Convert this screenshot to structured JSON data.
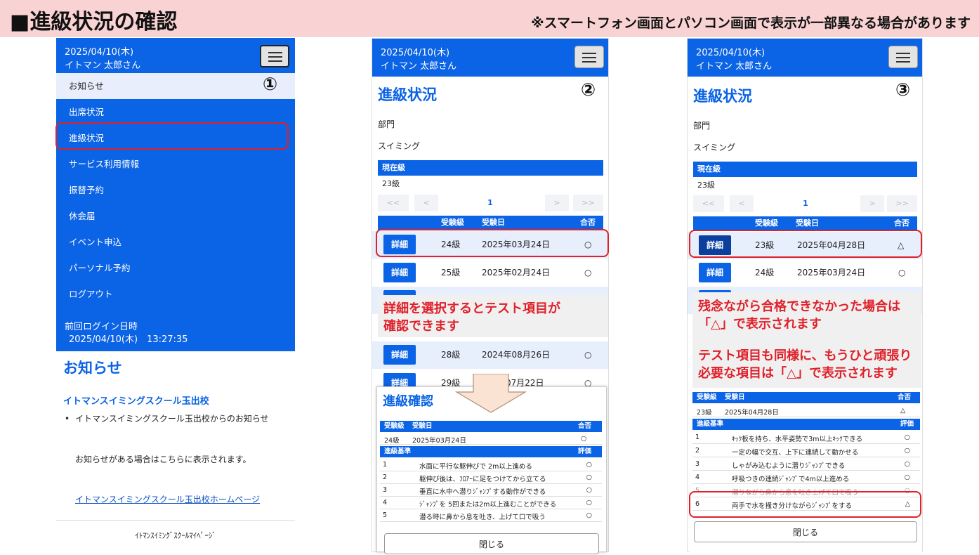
{
  "banner": {
    "title": "■進級状況の確認",
    "note": "※スマートフォン画面とパソコン画面で表示が一部異なる場合があります"
  },
  "header": {
    "date": "2025/04/10(木)",
    "user": "イトマン 太郎さん"
  },
  "panel1": {
    "badge": "①",
    "nav": [
      "お知らせ",
      "出席状況",
      "進級状況",
      "サービス利用情報",
      "振替予約",
      "休会届",
      "イベント申込",
      "パーソナル予約",
      "ログアウト"
    ],
    "last_login_label": "前回ログイン日時",
    "last_login_value": "2025/04/10(木)　13:27:35",
    "news_title": "お知らせ",
    "school_name": "イトマンスイミングスクール玉出校",
    "bullet": "イトマンスイミングスクール玉出校からのお知らせ",
    "news_note": "お知らせがある場合はこちらに表示されます。",
    "homepage_link": "イトマンスイミングスクール玉出校ホームページ",
    "footer": "ｲﾄﾏﾝｽｲﾐﾝｸﾞｽｸｰﾙﾏｲﾍﾟｰｼﾞ"
  },
  "progress": {
    "page_title": "進級状況",
    "dept_label": "部門",
    "dept_value": "スイミング",
    "current_label": "現在級",
    "current_value": "23級",
    "pager": {
      "first": "<<",
      "prev": "<",
      "page": "1",
      "next": ">",
      "last": ">>"
    },
    "columns": {
      "level": "受験級",
      "date": "受験日",
      "result": "合否"
    },
    "detail_label": "詳細"
  },
  "panel2": {
    "badge": "②",
    "rows": [
      {
        "level": "24級",
        "date": "2025年03月24日",
        "result": "○"
      },
      {
        "level": "25級",
        "date": "2025年02月24日",
        "result": "○"
      },
      {
        "level": "28級",
        "date": "2024年08月26日",
        "result": "○"
      },
      {
        "level": "29級",
        "date": "07月22日",
        "result": "○"
      }
    ],
    "callout": [
      "詳細を選択するとテスト項目が",
      "確認できます"
    ],
    "modal": {
      "title": "進級確認",
      "col_level": "受験級",
      "col_date": "受験日",
      "col_result": "合否",
      "level": "24級",
      "date": "2025年03月24日",
      "result": "○",
      "criteria_label": "進級基準",
      "eval_label": "評価",
      "items": [
        {
          "n": "1",
          "text": "水面に平行な躯伸びで 2m以上進める",
          "v": "○"
        },
        {
          "n": "2",
          "text": "躯伸び後は、ﾌﾛｱｰに足をつけてから立てる",
          "v": "○"
        },
        {
          "n": "3",
          "text": "垂直に水中へ潜りｼﾞｬﾝﾌﾟする動作ができる",
          "v": "○"
        },
        {
          "n": "4",
          "text": "ｼﾞｬﾝﾌﾟを 5回または2m以上進むことができる",
          "v": "○"
        },
        {
          "n": "5",
          "text": "潜る時に鼻から息を吐き、上げて口で吸う",
          "v": "○"
        }
      ],
      "close": "閉じる"
    }
  },
  "panel3": {
    "badge": "③",
    "rows": [
      {
        "level": "23級",
        "date": "2025年04月28日",
        "result": "△"
      },
      {
        "level": "24級",
        "date": "2025年03月24日",
        "result": "○"
      }
    ],
    "callout": [
      "残念ながら合格できなかった場合は",
      "「△」で表示されます",
      "",
      "テスト項目も同様に、もうひと頑張り",
      "必要な項目は「△」で表示されます"
    ],
    "modal": {
      "col_level": "受験級",
      "col_date": "受験日",
      "col_result": "合否",
      "level": "23級",
      "date": "2025年04月28日",
      "result": "△",
      "criteria_label": "進級基準",
      "eval_label": "評価",
      "items": [
        {
          "n": "1",
          "text": "ｷｯｸ板を持ち、水平姿勢で3m以上ｷｯｸできる",
          "v": "○"
        },
        {
          "n": "2",
          "text": "一定の幅で交互、上下に連続して動かせる",
          "v": "○"
        },
        {
          "n": "3",
          "text": "しゃがみ込むように潜りｼﾞｬﾝﾌﾟできる",
          "v": "○"
        },
        {
          "n": "4",
          "text": "呼吸つきの連続ｼﾞｬﾝﾌﾟで4m以上進める",
          "v": "○"
        },
        {
          "n": "5",
          "text": "潜りながら鼻から息を吐き上げて口で吸う",
          "v": "○"
        },
        {
          "n": "6",
          "text": "両手で水を掻き分けながらｼﾞｬﾝﾌﾟをする",
          "v": "△"
        }
      ],
      "close": "閉じる"
    }
  }
}
